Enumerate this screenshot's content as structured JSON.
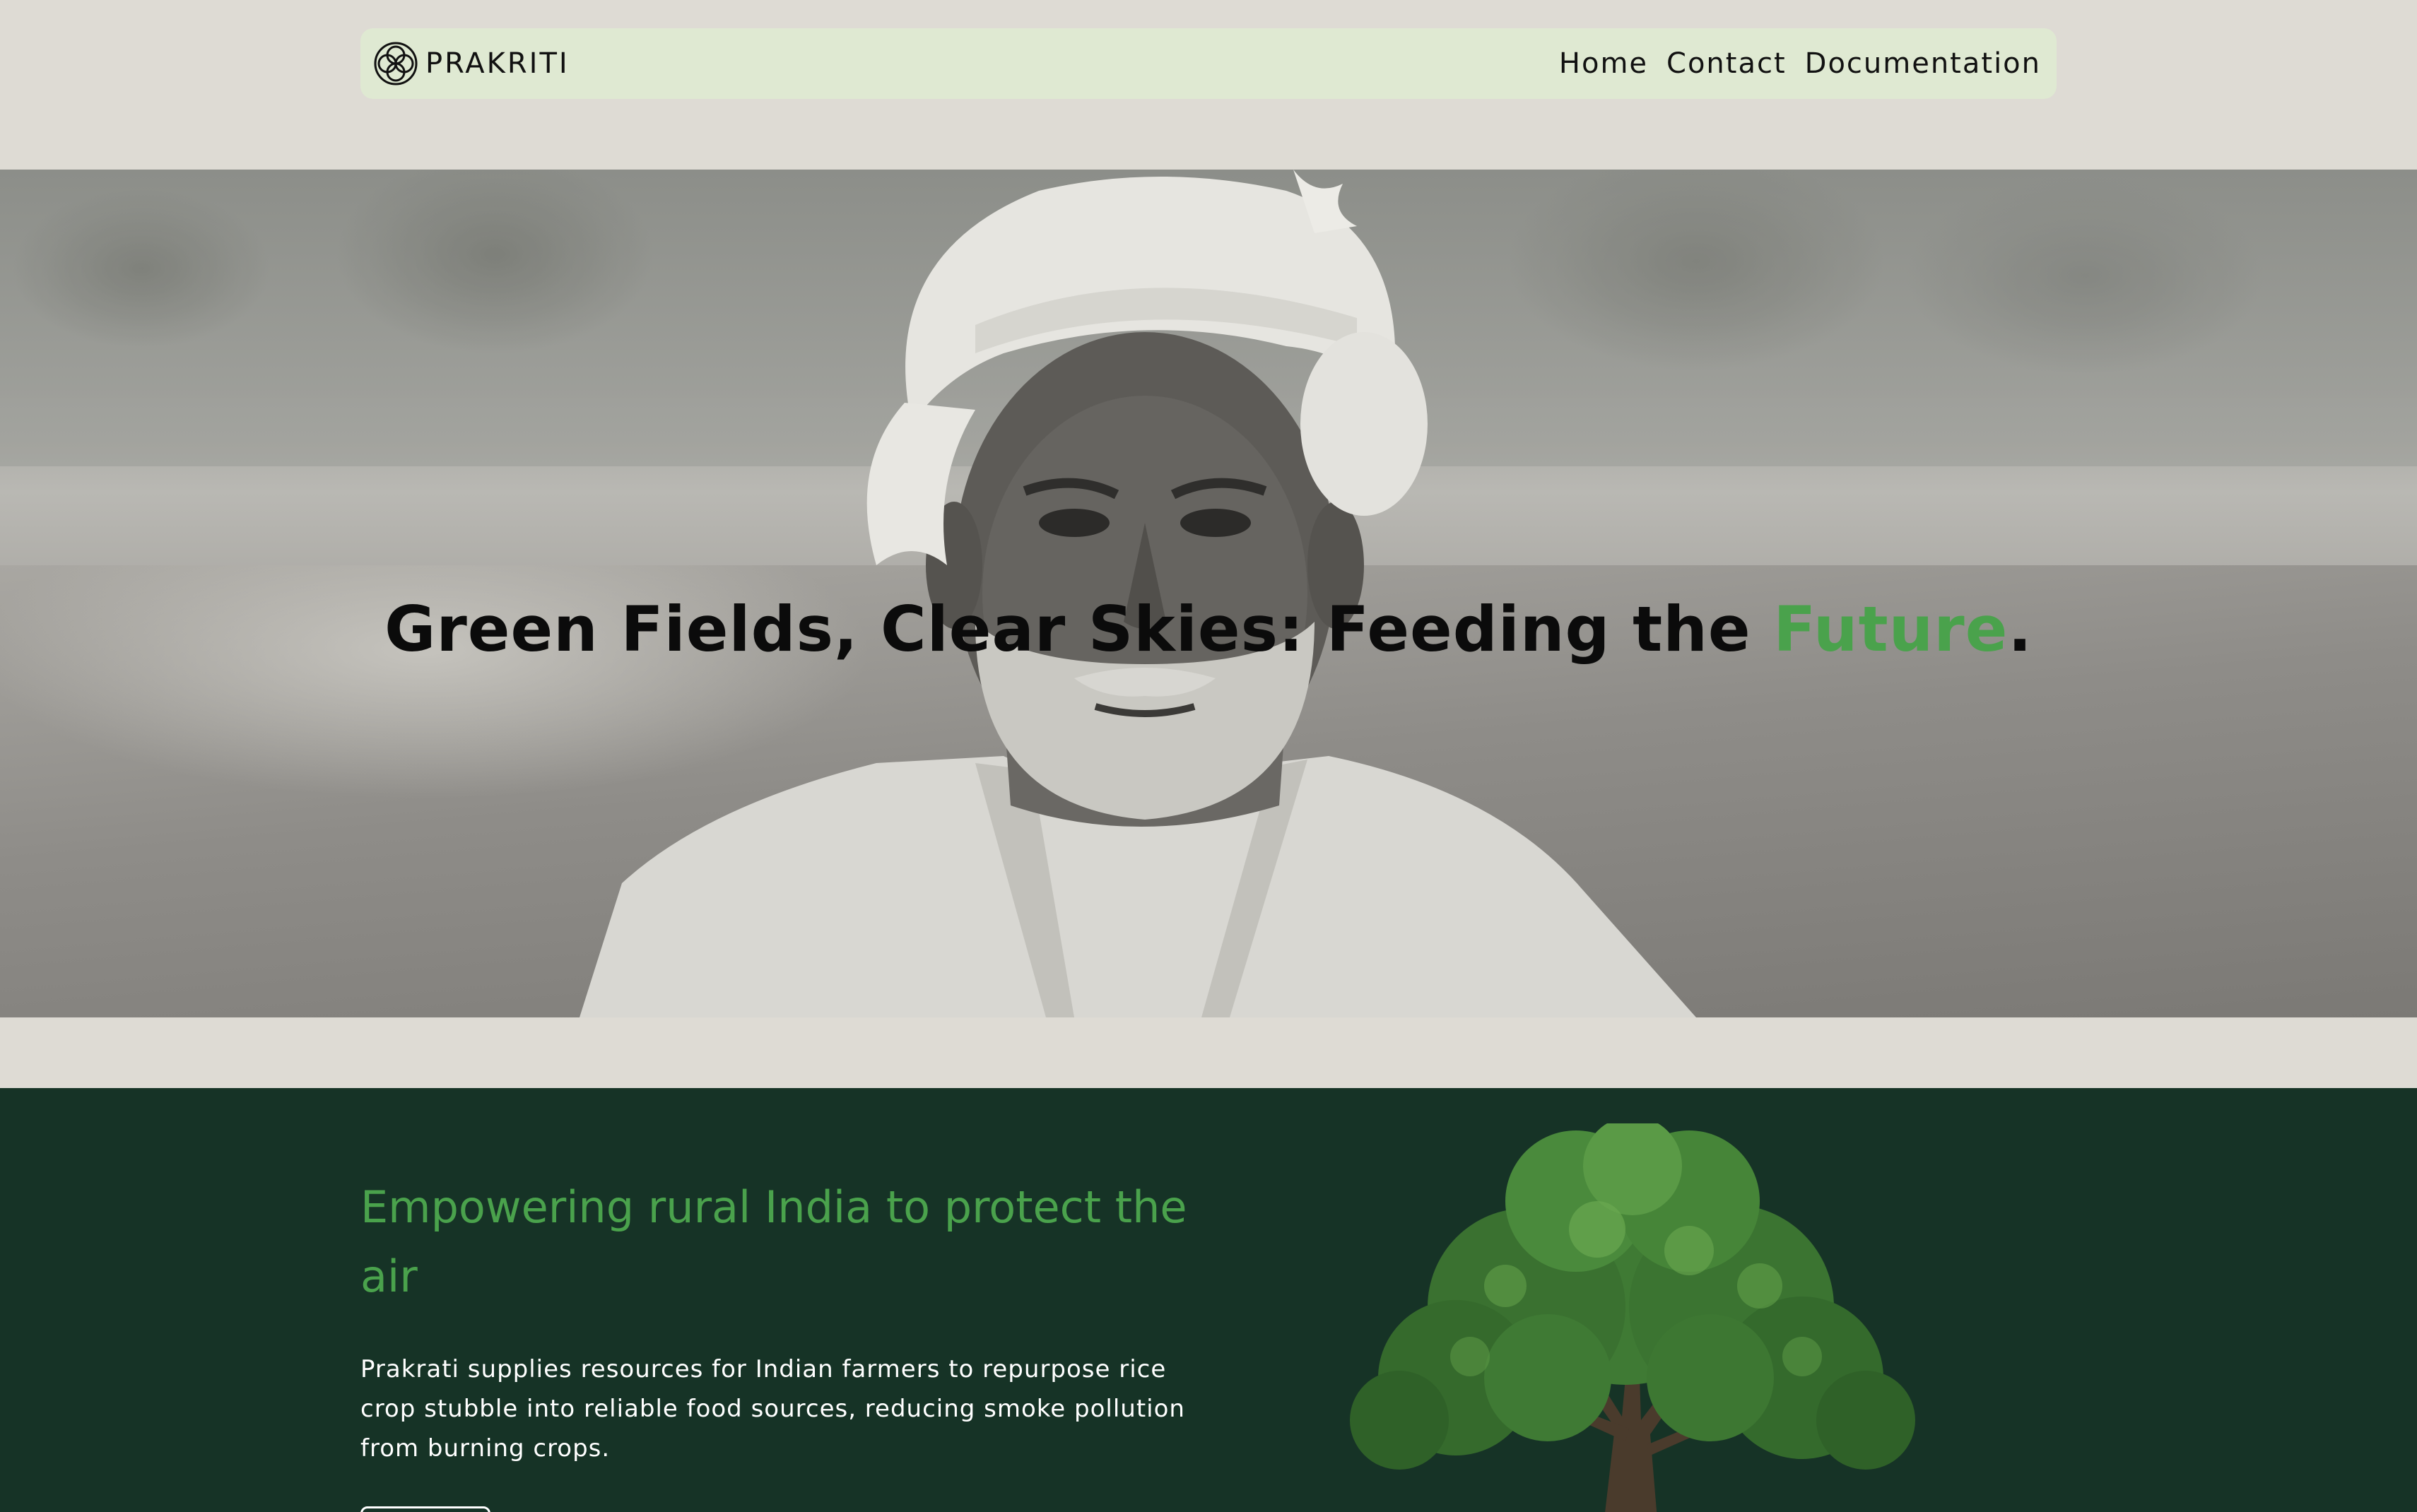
{
  "navbar": {
    "brand_name": "PRAKRITI",
    "logo_icon": "four-petal-flower-icon",
    "links": [
      {
        "label": "Home"
      },
      {
        "label": "Contact"
      },
      {
        "label": "Documentation"
      }
    ]
  },
  "hero": {
    "title_part1": "Green Fields, Clear Skies: Feeding the ",
    "title_accent": "Future",
    "title_end": ".",
    "image": "farmer-portrait-photo",
    "accent_color": "#4aa24c"
  },
  "mission": {
    "heading": "Empowering rural India to protect the air",
    "body": "Prakrati supplies resources for Indian farmers to repurpose rice crop stubble into reliable food sources, reducing smoke pollution from burning crops.",
    "image": "tree-illustration",
    "background_color": "#163326",
    "heading_color": "#4aa24c"
  },
  "colors": {
    "page_background": "#dedbd4",
    "navbar_background": "#dfe9d2",
    "text_dark": "#111111"
  }
}
